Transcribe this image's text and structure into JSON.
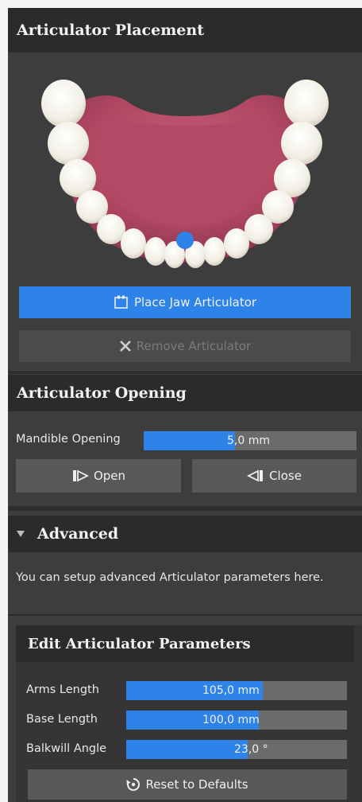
{
  "placement": {
    "title": "Articulator Placement",
    "place_button": "Place Jaw Articulator",
    "remove_button": "Remove Articulator"
  },
  "opening": {
    "title": "Articulator Opening",
    "mandible_label": "Mandible Opening",
    "mandible_value": "5,0 mm",
    "mandible_fraction": 0.43,
    "open_button": "Open",
    "close_button": "Close"
  },
  "advanced": {
    "title": "Advanced",
    "description": "You can setup advanced Articulator parameters here.",
    "edit_title": "Edit Articulator Parameters",
    "params": [
      {
        "label": "Arms Length",
        "value": "105,0 mm",
        "fraction": 0.62
      },
      {
        "label": "Base Length",
        "value": "100,0 mm",
        "fraction": 0.6
      },
      {
        "label": "Balkwill Angle",
        "value": "23,0 °",
        "fraction": 0.55
      }
    ],
    "reset_button": "Reset to Defaults"
  },
  "colors": {
    "accent": "#2d83e8",
    "panel": "#3d3d3d",
    "header": "#2b2b2b"
  }
}
